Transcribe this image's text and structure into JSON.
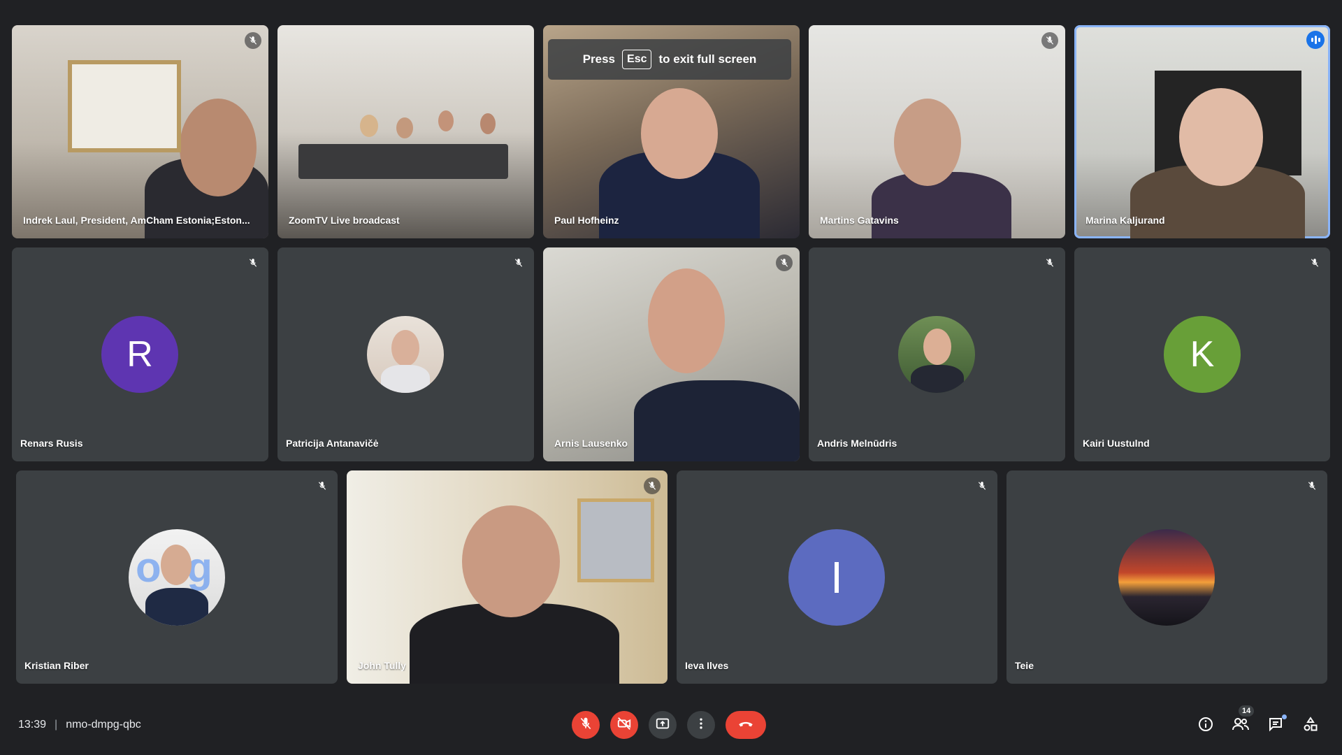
{
  "fullscreen_banner": {
    "press": "Press",
    "key": "Esc",
    "rest": "to exit full screen"
  },
  "participants": [
    {
      "name": "Indrek Laul, President, AmCham Estonia;Eston..."
    },
    {
      "name": "ZoomTV Live broadcast"
    },
    {
      "name": "Paul Hofheinz"
    },
    {
      "name": "Martins Gatavins"
    },
    {
      "name": "Marina Kaljurand"
    },
    {
      "name": "Renars Rusis",
      "initial": "R",
      "color": "#5e35b1"
    },
    {
      "name": "Patricija Antanavičė"
    },
    {
      "name": "Arnis Lausenko"
    },
    {
      "name": "Andris Melnūdris"
    },
    {
      "name": "Kairi Uustulnd",
      "initial": "K",
      "color": "#689f38"
    },
    {
      "name": "Kristian Riber"
    },
    {
      "name": "John Tully"
    },
    {
      "name": "Ieva Ilves",
      "initial": "I",
      "color": "#5c6bc0"
    },
    {
      "name": "Teie"
    }
  ],
  "footer": {
    "time": "13:39",
    "meeting_code": "nmo-dmpg-qbc",
    "people_count": "14"
  },
  "colors": {
    "background": "#202124",
    "tile": "#3c4043",
    "danger": "#ea4335",
    "accent": "#8ab4f8"
  },
  "icons": [
    "mic-off-icon",
    "camera-off-icon",
    "present-icon",
    "more-icon",
    "hang-up-icon",
    "info-icon",
    "people-icon",
    "chat-icon",
    "activities-icon"
  ]
}
